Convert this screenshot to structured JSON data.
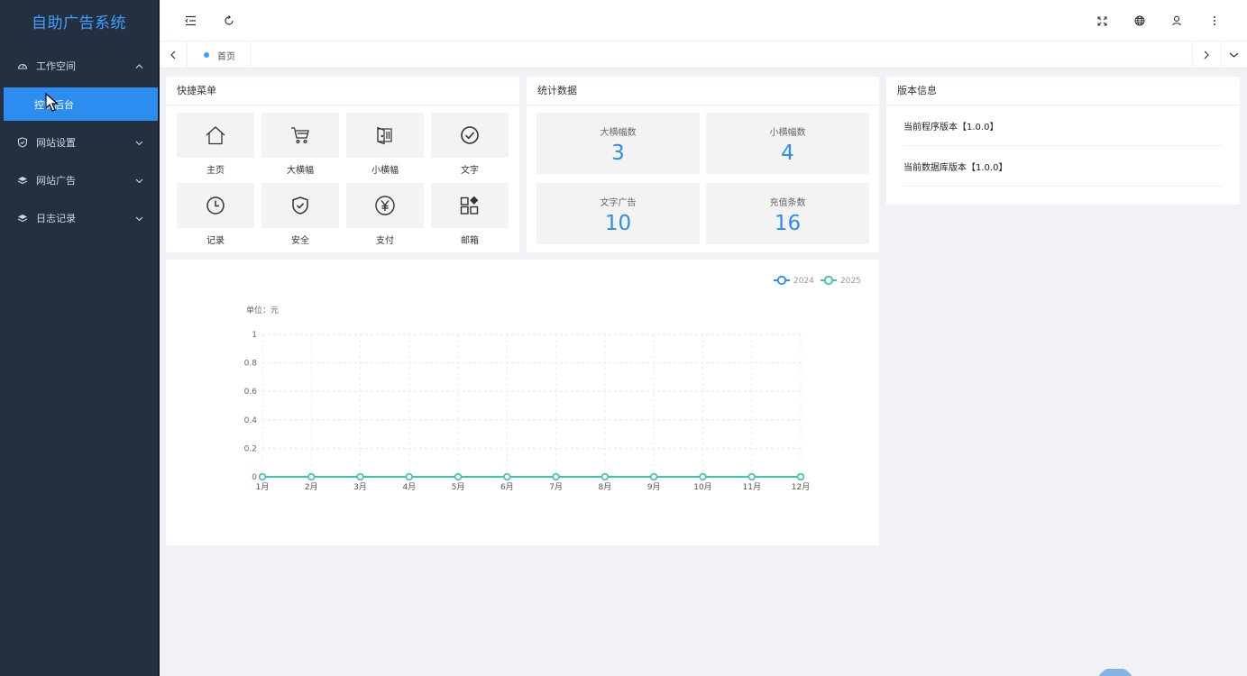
{
  "app": {
    "title": "自助广告系统"
  },
  "sidebar": {
    "items": [
      {
        "label": "工作空间",
        "icon": "dashboard-icon",
        "expanded": true
      },
      {
        "label": "网站设置",
        "icon": "shield-icon",
        "expanded": false
      },
      {
        "label": "网站广告",
        "icon": "layers-icon",
        "expanded": false
      },
      {
        "label": "日志记录",
        "icon": "layers-icon",
        "expanded": false
      }
    ],
    "active_sub": "控制后台"
  },
  "tabs": {
    "home": "首页"
  },
  "quick_menu": {
    "title": "快捷菜单",
    "items": [
      {
        "label": "主页",
        "icon": "home-icon"
      },
      {
        "label": "大横幅",
        "icon": "cart-icon"
      },
      {
        "label": "小横幅",
        "icon": "door-icon"
      },
      {
        "label": "文字",
        "icon": "check-circle-icon"
      },
      {
        "label": "记录",
        "icon": "clock-icon"
      },
      {
        "label": "安全",
        "icon": "shield-check-icon"
      },
      {
        "label": "支付",
        "icon": "yen-icon"
      },
      {
        "label": "邮箱",
        "icon": "apps-icon"
      }
    ]
  },
  "stats": {
    "title": "统计数据",
    "items": [
      {
        "label": "大横幅数",
        "value": "3"
      },
      {
        "label": "小横幅数",
        "value": "4"
      },
      {
        "label": "文字广告",
        "value": "10"
      },
      {
        "label": "充值条数",
        "value": "16"
      }
    ]
  },
  "version": {
    "title": "版本信息",
    "program": "当前程序版本【1.0.0】",
    "database": "当前数据库版本【1.0.0】"
  },
  "colors": {
    "accent": "#2d8cf0",
    "sidebar": "#243040",
    "series_2024": "#2d8cf0",
    "series_2025": "#3cc6a8"
  },
  "chart_data": {
    "type": "line",
    "ylabel": "单位：元",
    "categories": [
      "1月",
      "2月",
      "3月",
      "4月",
      "5月",
      "6月",
      "7月",
      "8月",
      "9月",
      "10月",
      "11月",
      "12月"
    ],
    "ylim": [
      0,
      1
    ],
    "yticks": [
      "0",
      "0.2",
      "0.4",
      "0.6",
      "0.8",
      "1"
    ],
    "series": [
      {
        "name": "2024",
        "color": "#2d8cf0",
        "values": [
          0,
          0,
          0,
          0,
          0,
          0,
          0,
          0,
          0,
          0,
          0,
          0
        ]
      },
      {
        "name": "2025",
        "color": "#3cc6a8",
        "values": [
          0,
          0,
          0,
          0,
          0,
          0,
          0,
          0,
          0,
          0,
          0,
          0
        ]
      }
    ],
    "grid": true,
    "legend": "top-right"
  }
}
